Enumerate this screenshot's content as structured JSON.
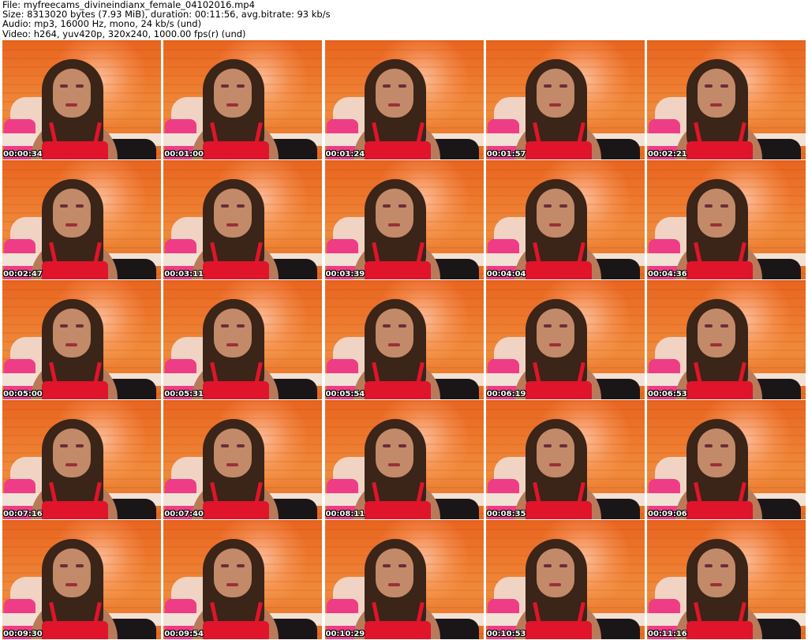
{
  "header": {
    "file_line": "File: myfreecams_divineindianx_female_04102016.mp4",
    "size_line": "Size: 8313020 bytes (7.93 MiB), duration: 00:11:56, avg.bitrate: 93 kb/s",
    "audio_line": "Audio: mp3, 16000 Hz, mono, 24 kb/s (und)",
    "video_line": "Video: h264, yuv420p, 320x240, 1000.00 fps(r) (und)"
  },
  "thumbnails": [
    {
      "timestamp": "00:00:34"
    },
    {
      "timestamp": "00:01:00"
    },
    {
      "timestamp": "00:01:24"
    },
    {
      "timestamp": "00:01:57"
    },
    {
      "timestamp": "00:02:21"
    },
    {
      "timestamp": "00:02:47"
    },
    {
      "timestamp": "00:03:11"
    },
    {
      "timestamp": "00:03:39"
    },
    {
      "timestamp": "00:04:04"
    },
    {
      "timestamp": "00:04:36"
    },
    {
      "timestamp": "00:05:00"
    },
    {
      "timestamp": "00:05:31"
    },
    {
      "timestamp": "00:05:54"
    },
    {
      "timestamp": "00:06:19"
    },
    {
      "timestamp": "00:06:53"
    },
    {
      "timestamp": "00:07:16"
    },
    {
      "timestamp": "00:07:40"
    },
    {
      "timestamp": "00:08:11"
    },
    {
      "timestamp": "00:08:35"
    },
    {
      "timestamp": "00:09:06"
    },
    {
      "timestamp": "00:09:30"
    },
    {
      "timestamp": "00:09:54"
    },
    {
      "timestamp": "00:10:29"
    },
    {
      "timestamp": "00:10:53"
    },
    {
      "timestamp": "00:11:16"
    }
  ],
  "colors": {
    "background": "#ffffff",
    "text": "#000000",
    "timestamp_text": "#ffffff",
    "wall_orange": "#ee7a2e",
    "top_red": "#e0142a",
    "pillow_pink": "#ee3d86"
  }
}
